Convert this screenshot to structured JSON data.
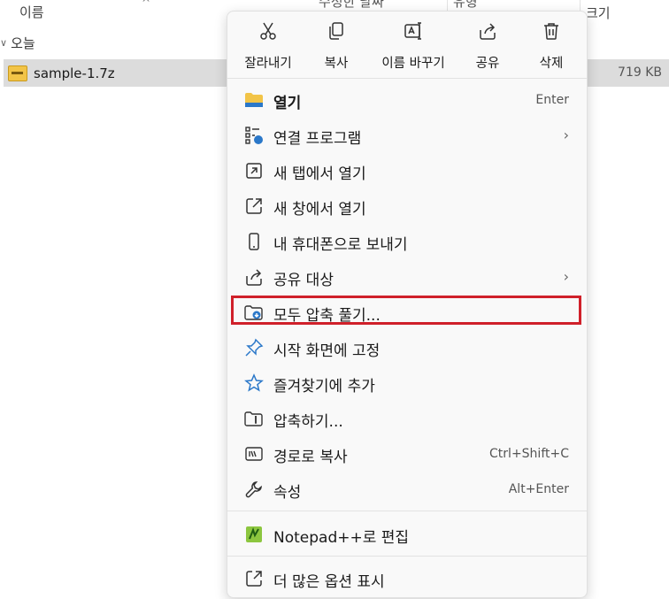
{
  "explorer": {
    "columns": {
      "name": "이름",
      "date": "수정한 날짜",
      "type": "유형",
      "size": "크기"
    },
    "group_label": "오늘",
    "file": {
      "name": "sample-1.7z",
      "size": "719 KB"
    }
  },
  "menu": {
    "toolbar": [
      {
        "id": "cut",
        "label": "잘라내기",
        "icon": "scissors-icon"
      },
      {
        "id": "copy",
        "label": "복사",
        "icon": "copy-icon"
      },
      {
        "id": "rename",
        "label": "이름 바꾸기",
        "icon": "rename-icon"
      },
      {
        "id": "share",
        "label": "공유",
        "icon": "share-icon"
      },
      {
        "id": "delete",
        "label": "삭제",
        "icon": "trash-icon"
      }
    ],
    "items": [
      {
        "label": "열기",
        "shortcut": "Enter",
        "icon": "folder-icon"
      },
      {
        "label": "연결 프로그램",
        "icon": "apps-icon",
        "submenu": true
      },
      {
        "label": "새 탭에서 열기",
        "icon": "new-tab-icon"
      },
      {
        "label": "새 창에서 열기",
        "icon": "external-window-icon"
      },
      {
        "label": "내 휴대폰으로 보내기",
        "icon": "phone-icon"
      },
      {
        "label": "공유 대상",
        "icon": "share-icon",
        "submenu": true
      },
      {
        "label": "모두 압축 풀기...",
        "icon": "extract-icon",
        "highlighted": true
      },
      {
        "label": "시작 화면에 고정",
        "icon": "pin-icon"
      },
      {
        "label": "즐겨찾기에 추가",
        "icon": "star-icon"
      },
      {
        "label": "압축하기...",
        "icon": "zip-folder-icon"
      },
      {
        "label": "경로로 복사",
        "shortcut": "Ctrl+Shift+C",
        "icon": "path-icon"
      },
      {
        "label": "속성",
        "shortcut": "Alt+Enter",
        "icon": "wrench-icon"
      },
      {
        "label": "Notepad++로 편집",
        "icon": "notepadpp-icon"
      },
      {
        "label": "더 많은 옵션 표시",
        "icon": "more-options-icon"
      }
    ]
  },
  "colors": {
    "highlight_border": "#d0202a",
    "selection_bg": "#dcdcdc",
    "accent": "#0067c0",
    "folder": "#f2c447"
  }
}
